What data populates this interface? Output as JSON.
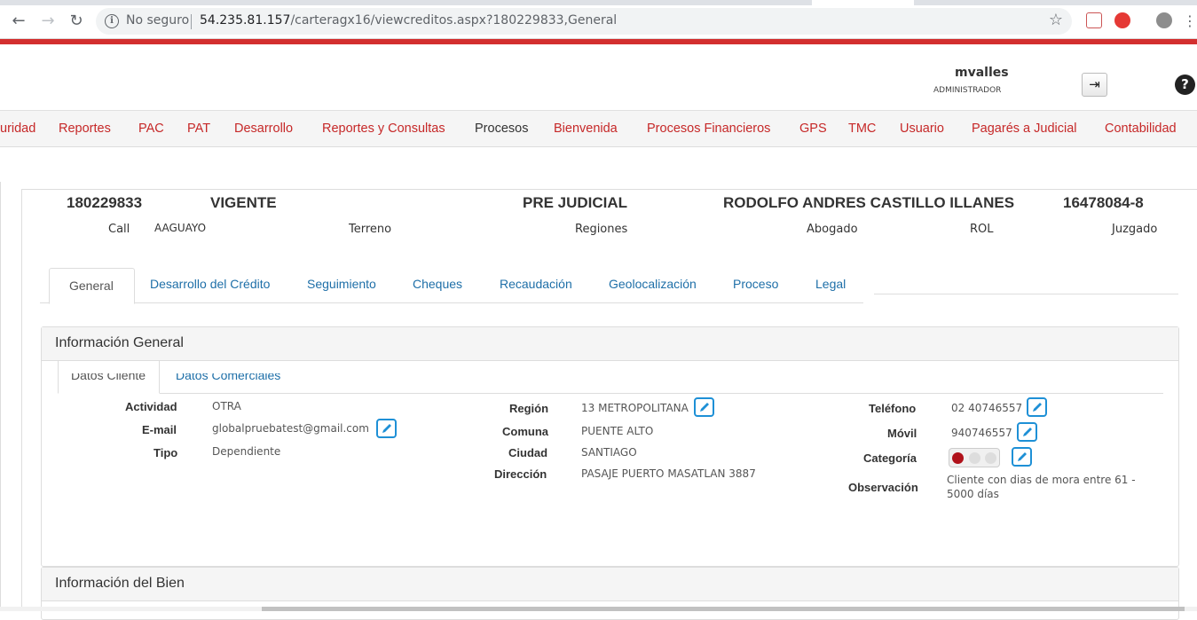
{
  "browser": {
    "security_label": "No seguro",
    "url_host": "54.235.81.157",
    "url_path": "/carteragx16/viewcreditos.aspx?180229833,General"
  },
  "header": {
    "username": "mvalles",
    "role": "ADMINISTRADOR"
  },
  "menu": [
    "uridad",
    "Reportes",
    "PAC",
    "PAT",
    "Desarrollo",
    "Reportes y Consultas",
    "Procesos",
    "Bienvenida",
    "Procesos Financieros",
    "GPS",
    "TMC",
    "Usuario",
    "Pagarés a Judicial",
    "Contabilidad"
  ],
  "credit": {
    "number": "180229833",
    "status": "VIGENTE",
    "stage": "PRE JUDICIAL",
    "client_name": "RODOLFO ANDRES CASTILLO ILLANES",
    "rut": "16478084-8",
    "call_label": "Call",
    "call_value": "AAGUAYO",
    "terreno_label": "Terreno",
    "regiones_label": "Regiones",
    "abogado_label": "Abogado",
    "rol_label": "ROL",
    "juzgado_label": "Juzgado"
  },
  "tabs": [
    "General",
    "Desarrollo del Crédito",
    "Seguimiento",
    "Cheques",
    "Recaudación",
    "Geolocalización",
    "Proceso",
    "Legal"
  ],
  "panel_general": {
    "title": "Información General",
    "subtabs": [
      "Datos Cliente",
      "Datos Comerciales"
    ],
    "fields": {
      "actividad_label": "Actividad",
      "actividad": "OTRA",
      "email_label": "E-mail",
      "email": "globalpruebatest@gmail.com",
      "tipo_label": "Tipo",
      "tipo": "Dependiente",
      "region_label": "Región",
      "region": "13 METROPOLITANA",
      "comuna_label": "Comuna",
      "comuna": "PUENTE ALTO",
      "ciudad_label": "Ciudad",
      "ciudad": "SANTIAGO",
      "direccion_label": "Dirección",
      "direccion": "PASAJE PUERTO MASATLAN 3887",
      "telefono_label": "Teléfono",
      "telefono": "02 40746557",
      "movil_label": "Móvil",
      "movil": "940746557",
      "categoria_label": "Categoría",
      "observacion_label": "Observación",
      "observacion": "Cliente con dias de mora entre 61 - 5000 días"
    },
    "categoria_colors": [
      "#b0121b",
      "#dddddd",
      "#dddddd"
    ]
  },
  "panel_bien": {
    "title": "Información del Bien"
  },
  "icons": {
    "edit": "pencil-edit-icon",
    "logout": "logout-icon",
    "help": "help-icon"
  }
}
